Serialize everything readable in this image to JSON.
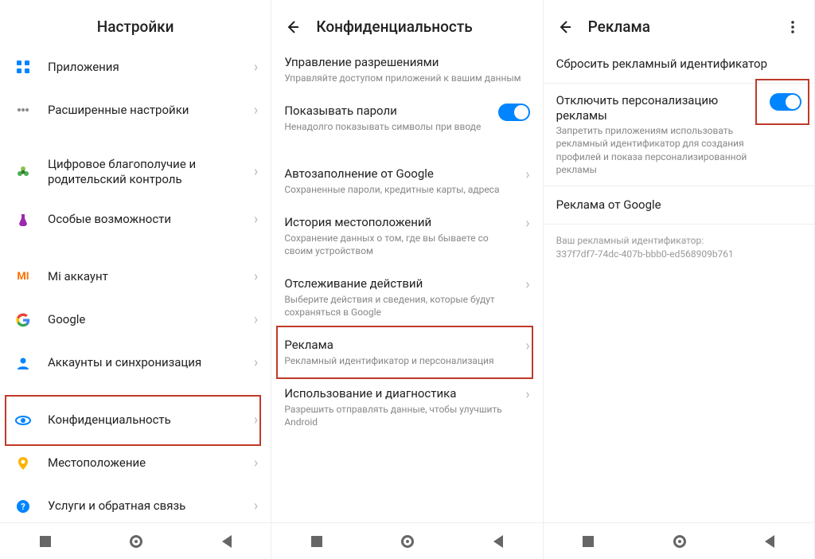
{
  "pane1": {
    "title": "Настройки",
    "items": [
      {
        "label": "Приложения",
        "icon": "grid",
        "color": "#0084ff"
      },
      {
        "label": "Расширенные настройки",
        "icon": "dots",
        "color": "#888"
      },
      {
        "label": "Цифровое благополучие и родительский контроль",
        "icon": "flower",
        "color": "#4caf50"
      },
      {
        "label": "Особые возможности",
        "icon": "potion",
        "color": "#9c27b0"
      },
      {
        "label": "Mi аккаунт",
        "icon": "mi",
        "color": "#ff6f00"
      },
      {
        "label": "Google",
        "icon": "google",
        "color": "#4285f4"
      },
      {
        "label": "Аккаунты и синхронизация",
        "icon": "person",
        "color": "#0084ff"
      },
      {
        "label": "Конфиденциальность",
        "icon": "eye",
        "color": "#0084ff",
        "hl": true
      },
      {
        "label": "Местоположение",
        "icon": "pin",
        "color": "#ffb300"
      },
      {
        "label": "Услуги и обратная связь",
        "icon": "help",
        "color": "#0084ff"
      }
    ]
  },
  "pane2": {
    "title": "Конфиденциальность",
    "items": [
      {
        "label": "Управление разрешениями",
        "sub": "Управляйте доступом приложений к вашим данным"
      },
      {
        "label": "Показывать пароли",
        "sub": "Ненадолго показывать символы при вводе",
        "toggle": true
      },
      {
        "label": "Автозаполнение от Google",
        "sub": "Сохраненные пароли, кредитные карты, адреса"
      },
      {
        "label": "История местоположений",
        "sub": "Сохранение данных о том, где вы бываете со своим устройством"
      },
      {
        "label": "Отслеживание действий",
        "sub": "Выберите действия и сведения, которые будут сохраняться в Google"
      },
      {
        "label": "Реклама",
        "sub": "Рекламный идентификатор и персонализация",
        "hl": true
      },
      {
        "label": "Использование и диагностика",
        "sub": "Разрешить отправлять данные, чтобы улучшить Android"
      }
    ]
  },
  "pane3": {
    "title": "Реклама",
    "items": [
      {
        "label": "Сбросить рекламный идентификатор"
      },
      {
        "label": "Отключить персонализацию рекламы",
        "sub": "Запретить приложениям использовать рекламный идентификатор для создания профилей и показа персонализированной рекламы",
        "toggle": true,
        "hl_toggle": true
      },
      {
        "label": "Реклама от Google"
      }
    ],
    "footer_label": "Ваш рекламный идентификатор:",
    "footer_value": "337f7df7-74dc-407b-bbb0-ed568909b761"
  }
}
